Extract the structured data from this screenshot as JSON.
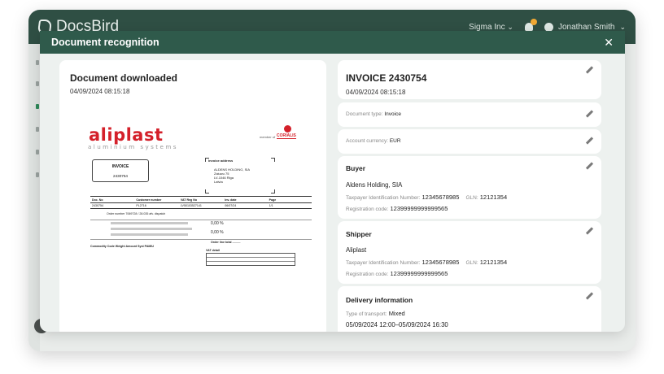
{
  "app": {
    "brand": "DocsBird",
    "company": "Sigma Inc",
    "user": "Jonathan Smith"
  },
  "modal": {
    "title": "Document recognition",
    "close": "✕"
  },
  "document": {
    "title": "Document downloaded",
    "date": "04/09/2024 08:15:18"
  },
  "preview": {
    "logo": "aliplast",
    "logo_sub": "aluminium systems",
    "member": "member of",
    "corialis": "CORIALIS",
    "invoice_label": "INVOICE",
    "invoice_no": "2430754",
    "address_title": "Invoice address",
    "address_lines": [
      "ALDENS HOLDING, SIA",
      "Zaiuwu 75",
      "LV-1046 Riga",
      "Latvia"
    ],
    "table_header": [
      "Doc. No",
      "Customer number",
      "VAT Reg No",
      "Inv. date",
      "Page"
    ],
    "table_values": [
      "2430754",
      "PL2716",
      "LV50103527141",
      "06/07/24",
      "1/1"
    ],
    "order_text": "Order number  7069728 / 28.035 afv. dispatch",
    "pct1": "0,00 %",
    "pct2": "0,00 %",
    "order_total": "Order line total ..........",
    "commodity": "Commodity Code   Weight   Amount   Syst   PAMIU",
    "vat_label": "VAT detail"
  },
  "invoice": {
    "title": "INVOICE 2430754",
    "date": "04/09/2024 08:15:18",
    "doc_type_label": "Document type:",
    "doc_type": "Invoice",
    "currency_label": "Account currency:",
    "currency": "EUR"
  },
  "buyer": {
    "heading": "Buyer",
    "name": "Aldens Holding, SIA",
    "tin_label": "Taxpayer Identification Number:",
    "tin": "12345678985",
    "gln_label": "GLN:",
    "gln": "12121354",
    "reg_label": "Registration code:",
    "reg": "12399999999999565"
  },
  "shipper": {
    "heading": "Shipper",
    "name": "Aliplast",
    "tin_label": "Taxpayer Identification Number:",
    "tin": "12345678985",
    "gln_label": "GLN:",
    "gln": "12121354",
    "reg_label": "Registration code:",
    "reg": "12399999999999565"
  },
  "delivery": {
    "heading": "Delivery information",
    "transport_label": "Type of transport:",
    "transport": "Mixed",
    "window": "05/09/2024 12:00–05/09/2024 16:30"
  }
}
